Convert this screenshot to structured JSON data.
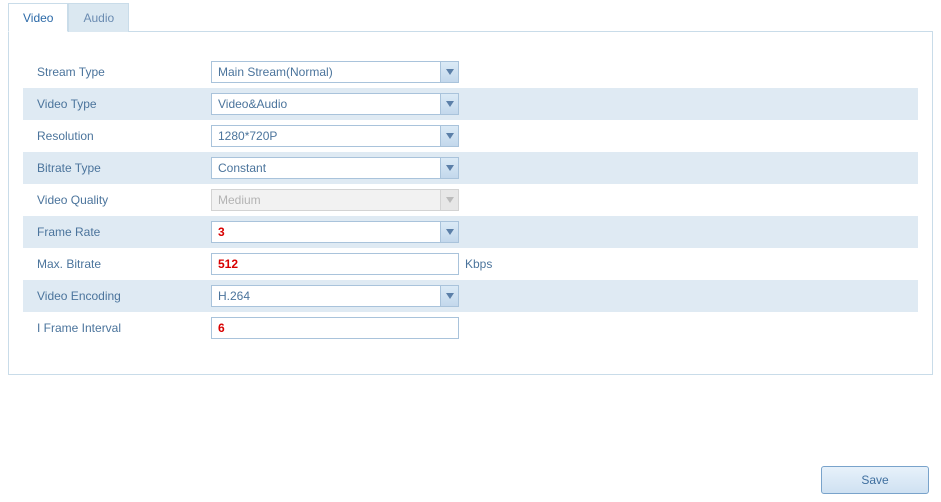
{
  "tabs": {
    "video": "Video",
    "audio": "Audio"
  },
  "labels": {
    "stream_type": "Stream Type",
    "video_type": "Video Type",
    "resolution": "Resolution",
    "bitrate_type": "Bitrate Type",
    "video_quality": "Video Quality",
    "frame_rate": "Frame Rate",
    "max_bitrate": "Max. Bitrate",
    "video_encoding": "Video Encoding",
    "i_frame_interval": "I Frame Interval"
  },
  "values": {
    "stream_type": "Main Stream(Normal)",
    "video_type": "Video&Audio",
    "resolution": "1280*720P",
    "bitrate_type": "Constant",
    "video_quality": "Medium",
    "frame_rate": "3",
    "max_bitrate": "512",
    "video_encoding": "H.264",
    "i_frame_interval": "6"
  },
  "units": {
    "max_bitrate": "Kbps"
  },
  "buttons": {
    "save": "Save"
  }
}
